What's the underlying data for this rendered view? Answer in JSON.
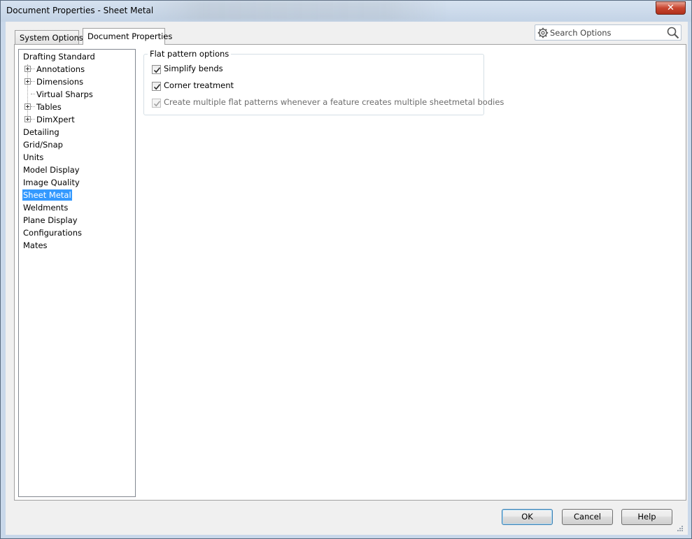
{
  "window": {
    "title": "Document Properties - Sheet Metal",
    "close_label": "✕"
  },
  "tabs": [
    {
      "label": "System Options",
      "active": false
    },
    {
      "label": "Document Properties",
      "active": true
    }
  ],
  "search": {
    "placeholder": "Search Options",
    "value": ""
  },
  "tree": {
    "items": [
      {
        "label": "Drafting Standard",
        "level": 0,
        "expandable": false,
        "selected": false
      },
      {
        "label": "Annotations",
        "level": 1,
        "expandable": true,
        "selected": false
      },
      {
        "label": "Dimensions",
        "level": 1,
        "expandable": true,
        "selected": false
      },
      {
        "label": "Virtual Sharps",
        "level": 1,
        "expandable": false,
        "selected": false
      },
      {
        "label": "Tables",
        "level": 1,
        "expandable": true,
        "selected": false
      },
      {
        "label": "DimXpert",
        "level": 1,
        "expandable": true,
        "selected": false
      },
      {
        "label": "Detailing",
        "level": 0,
        "expandable": false,
        "selected": false
      },
      {
        "label": "Grid/Snap",
        "level": 0,
        "expandable": false,
        "selected": false
      },
      {
        "label": "Units",
        "level": 0,
        "expandable": false,
        "selected": false
      },
      {
        "label": "Model Display",
        "level": 0,
        "expandable": false,
        "selected": false
      },
      {
        "label": "Image Quality",
        "level": 0,
        "expandable": false,
        "selected": false
      },
      {
        "label": "Sheet Metal",
        "level": 0,
        "expandable": false,
        "selected": true
      },
      {
        "label": "Weldments",
        "level": 0,
        "expandable": false,
        "selected": false
      },
      {
        "label": "Plane Display",
        "level": 0,
        "expandable": false,
        "selected": false
      },
      {
        "label": "Configurations",
        "level": 0,
        "expandable": false,
        "selected": false
      },
      {
        "label": "Mates",
        "level": 0,
        "expandable": false,
        "selected": false
      }
    ]
  },
  "flat_pattern": {
    "legend": "Flat pattern options",
    "options": [
      {
        "label": "Simplify bends",
        "checked": true,
        "enabled": true
      },
      {
        "label": "Corner treatment",
        "checked": true,
        "enabled": true
      },
      {
        "label": "Create multiple flat patterns whenever a feature creates multiple sheetmetal bodies",
        "checked": true,
        "enabled": false
      }
    ]
  },
  "buttons": {
    "ok": "OK",
    "cancel": "Cancel",
    "help": "Help"
  },
  "colors": {
    "selection": "#3399ff",
    "title_bar": "#c9d8ea",
    "close_button": "#c8452f"
  }
}
